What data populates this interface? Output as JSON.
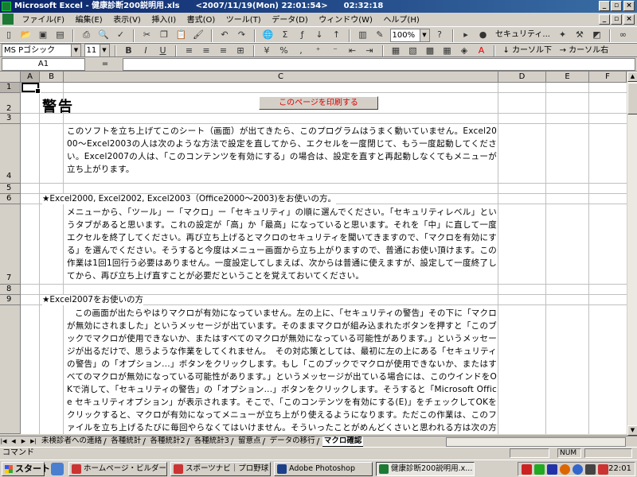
{
  "window": {
    "title": "Microsoft Excel - 健康診断200説明用.xls　　<2007/11/19(Mon) 22:01:54>　　02:32:18",
    "min": "_",
    "restore": "▫",
    "close": "×"
  },
  "menu": [
    "ファイル(F)",
    "編集(E)",
    "表示(V)",
    "挿入(I)",
    "書式(O)",
    "ツール(T)",
    "データ(D)",
    "ウィンドウ(W)",
    "ヘルプ(H)"
  ],
  "toolbar": {
    "zoom": "100%",
    "help_label": "?",
    "security_label": "セキュリティ...",
    "font": "MS Pゴシック",
    "size": "11",
    "bold": "B",
    "italic": "I",
    "underline": "U",
    "percent": "%",
    "comma": ",",
    "cursor_down": "カーソル下",
    "cursor_right": "カーソル右"
  },
  "formula_bar": {
    "cell": "A1",
    "fx": "=",
    "value": ""
  },
  "columns": [
    "A",
    "B",
    "C",
    "D",
    "E",
    "F"
  ],
  "rows": [
    "1",
    "2",
    "3",
    "4",
    "5",
    "6",
    "7",
    "8",
    "9"
  ],
  "sheet": {
    "heading": "警告",
    "print_button": "このページを印刷する",
    "intro": "このソフトを立ち上げてこのシート（画面）が出てきたら、このプログラムはうまく動いていません。Excel2000～Excel2003の人は次のような方法で設定を直してから、エクセルを一度閉じて、もう一度起動してください。Excel2007の人は、「このコンテンツを有効にする」の場合は、設定を直すと再起動しなくてもメニューが立ち上がります。",
    "section1_title": "★Excel2000, Excel2002, Excel2003（Office2000～2003)をお使いの方。",
    "section1_body": "メニューから、「ツール」ー「マクロ」ー「セキュリティ」の順に選んでください。「セキュリティレベル」というタブがあると思います。これの設定が「高」か「最高」になっていると思います。それを「中」に直して一度エクセルを終了してください。再び立ち上げるとマクロのセキュリティを聞いてきますので、「マクロを有効にする」を選んでください。そうすると今度はメニュー画面から立ち上がりますので、普通にお使い頂けます。この作業は1回1回行う必要はありません。一度設定してしまえば、次からは普通に使えますが、設定して一度終了してから、再び立ち上げ直すことが必要だということを覚えておいてください。",
    "section2_title": "★Excel2007をお使いの方",
    "section2_body": "この画面が出たらやはりマクロが有効になっていません。左の上に、「セキュリティの警告」その下に「マクロが無効にされました」というメッセージが出ています。そのままマクロが組み込まれたボタンを押すと「このブックでマクロが使用できないか、またはすべてのマクロが無効になっている可能性があります。」というメッセージが出るだけで、思うような作業をしてくれません。　その対応策としては、最初に左の上にある「セキュリティの警告」の「オプション...」ボタンをクリックします。もし「このブックでマクロが使用できないか、またはすべてのマクロが無効になっている可能性があります。」というメッセージが出ている場合には、このウインドをOKで消して、「セキュリティの警告」の「オプション...」ボタンをクリックします。そうすると「Microsoft Office セキュリティオプション」が表示されます。そこで、「このコンテンツを有効にする(E)」をチェックしてOKをクリックすると、マクロが有効になってメニューが立ち上がり使えるようになります。ただこの作業は、このファイルを立ち上げるたびに毎回やらなくてはいけません。そういったことがめんどくさいと思われる方は次の方法で設定してください。"
  },
  "tabs": [
    "未検診者への連絡",
    "各種統計",
    "各種統計2",
    "各種統計3",
    "留意点",
    "データの移行",
    "マクロ確認"
  ],
  "status": {
    "text": "コマンド",
    "num": "NUM"
  },
  "taskbar": {
    "start": "スタート",
    "tasks": [
      "ホームページ・ビルダー - [",
      "スポーツナビ｜プロ野球｜...",
      "Adobe Photoshop",
      "健康診断200説明用.x..."
    ],
    "clock": "22:01"
  },
  "colors": {
    "title_start": "#0a246a",
    "title_end": "#3a6ea5",
    "print_text": "#e00000"
  }
}
